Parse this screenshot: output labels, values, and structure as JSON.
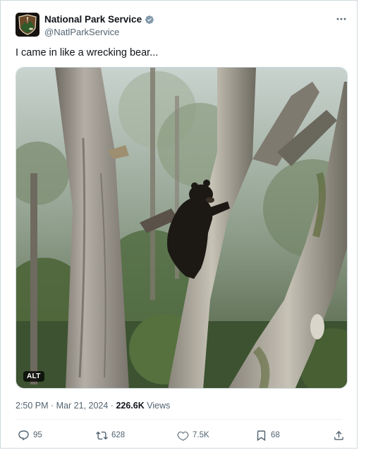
{
  "author": {
    "display_name": "National Park Service",
    "handle": "@NatlParkService"
  },
  "post": {
    "text": "I came in like a wrecking bear...",
    "media_badge": "ALT",
    "timestamp": "2:50 PM · Mar 21, 2024",
    "separator": " · ",
    "views_count": "226.6K",
    "views_label": " Views"
  },
  "actions": {
    "replies": "95",
    "reposts": "628",
    "likes": "7.5K",
    "bookmarks": "68"
  },
  "icons": [
    "nps-logo-icon",
    "verified-badge-icon",
    "more-options-icon",
    "reply-icon",
    "repost-icon",
    "like-icon",
    "bookmark-icon",
    "share-icon"
  ],
  "colors": {
    "verified": "#829aab",
    "secondary_text": "#536471",
    "primary_text": "#0f1419"
  }
}
